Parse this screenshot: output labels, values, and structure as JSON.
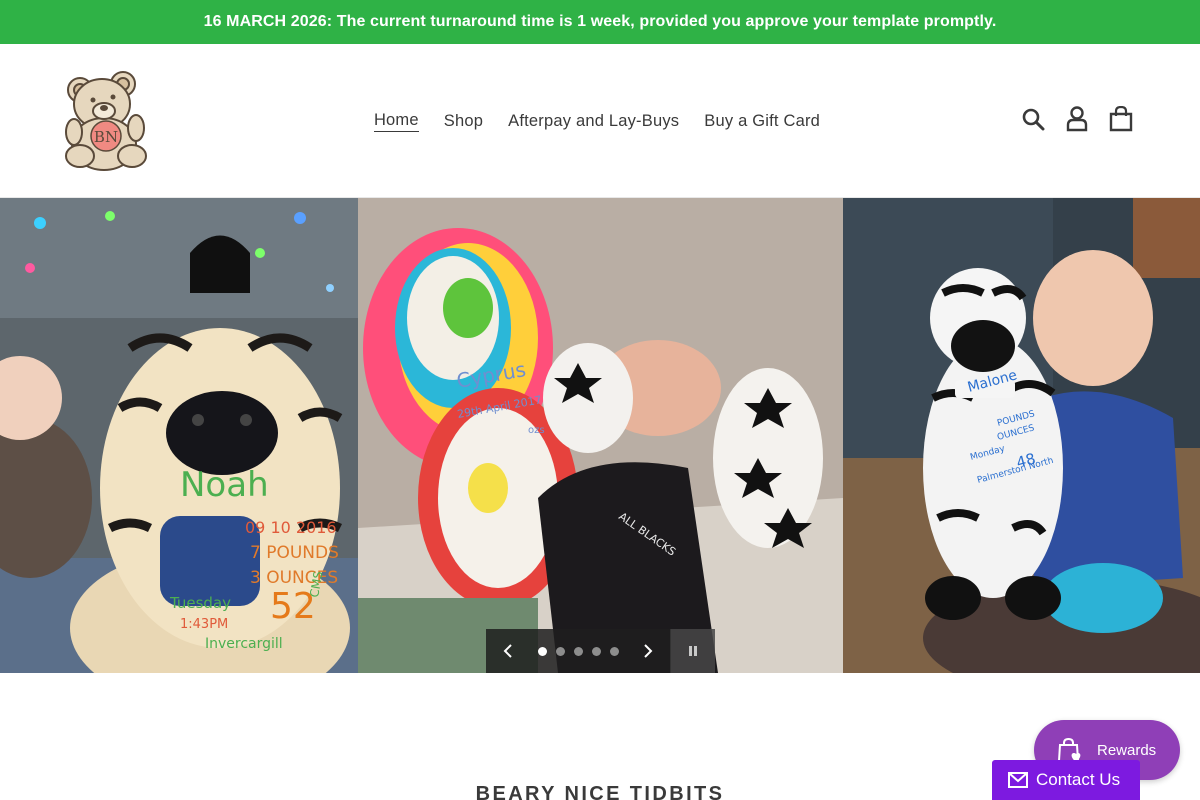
{
  "announcement": {
    "text": "16 MARCH 2026: The current turnaround time is 1 week, provided you approve your template promptly."
  },
  "brand": {
    "logo_monogram": "BN",
    "accent_green": "#2fb246"
  },
  "nav": {
    "items": [
      {
        "label": "Home",
        "active": true
      },
      {
        "label": "Shop"
      },
      {
        "label": "Afterpay and Lay-Buys"
      },
      {
        "label": "Buy a Gift Card"
      }
    ]
  },
  "header_icons": [
    "search-icon",
    "account-icon",
    "cart-icon"
  ],
  "slideshow": {
    "slide_count": 5,
    "active_slide": 1,
    "controls": [
      "chevron-left-icon",
      "chevron-right-icon",
      "pause-icon"
    ],
    "panel_texts": {
      "p1": [
        "Noah",
        "09 10 2016",
        "7 POUNDS",
        "3 OUNCES",
        "52",
        "CMS",
        "Tuesday",
        "1:43PM",
        "Invercargill"
      ],
      "p2": [
        "Cyprus",
        "29th April 2017",
        "ozs",
        "ALL BLACKS"
      ],
      "p3": [
        "Malone",
        "POUNDS",
        "OUNCES",
        "48",
        "Monday",
        "Palmerston North"
      ]
    }
  },
  "section": {
    "title": "BEARY NICE TIDBITS"
  },
  "widgets": {
    "rewards_label": "Rewards",
    "rewards_color": "#8f3fb7",
    "contact_label": "Contact Us",
    "contact_color": "#7d1ae0"
  }
}
